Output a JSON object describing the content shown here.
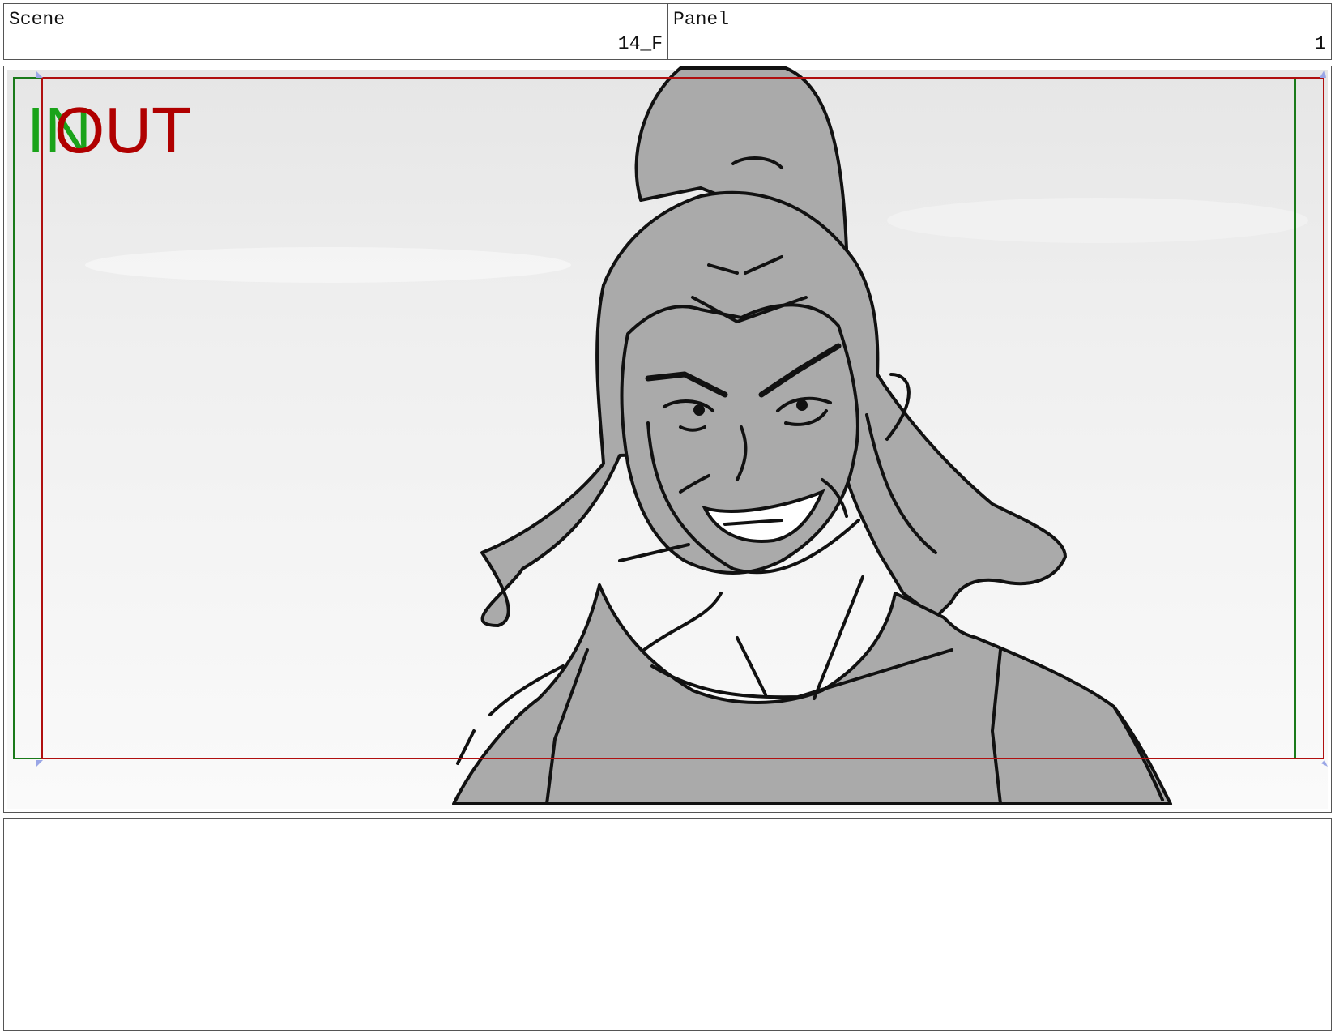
{
  "header": {
    "scene_label": "Scene",
    "scene_value": "14_F",
    "panel_label": "Panel",
    "panel_value": "1"
  },
  "frame": {
    "in_label": "IN",
    "out_label": "OUT",
    "in_color": "#1aa31a",
    "out_color": "#b00000",
    "safe_in_color": "#1a7a1a",
    "safe_out_color": "#b01010",
    "fill_color": "#aaaaaa",
    "line_color": "#111111"
  },
  "notes": {
    "text": ""
  }
}
